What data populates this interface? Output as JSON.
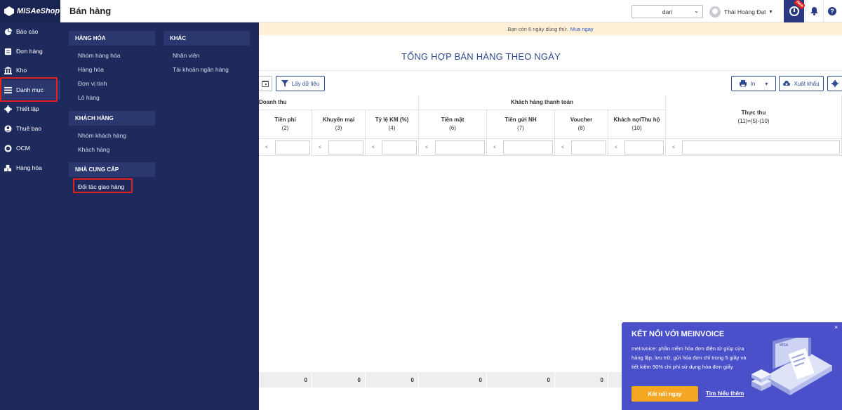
{
  "brand": {
    "name": "MISAeShop"
  },
  "sidebar": {
    "items": [
      {
        "label": "Báo cáo",
        "icon": "pie-chart-icon"
      },
      {
        "label": "Đơn hàng",
        "icon": "order-icon"
      },
      {
        "label": "Kho",
        "icon": "warehouse-icon"
      },
      {
        "label": "Danh mục",
        "icon": "list-icon"
      },
      {
        "label": "Thiết lập",
        "icon": "gear-icon"
      },
      {
        "label": "Thuê bao",
        "icon": "user-icon"
      },
      {
        "label": "OCM",
        "icon": "ocm-icon"
      },
      {
        "label": "Hàng hóa",
        "icon": "boxes-icon"
      }
    ]
  },
  "header": {
    "title": "Bán hàng",
    "store": "dari",
    "user": "Thái Hoàng Đạt",
    "new_badge": "New"
  },
  "trial": {
    "text": "Bạn còn 6 ngày dùng thử.",
    "link": "Mua ngay"
  },
  "menu": {
    "hang_hoa": {
      "title": "HÀNG HÓA",
      "items": [
        "Nhóm hàng hóa",
        "Hàng hóa",
        "Đơn vị tính",
        "Lô hàng"
      ]
    },
    "khach_hang": {
      "title": "KHÁCH HÀNG",
      "items": [
        "Nhóm khách hàng",
        "Khách hàng"
      ]
    },
    "nha_cung_cap": {
      "title": "NHÀ CUNG CẤP",
      "items": [
        "Đối tác giao hàng"
      ]
    },
    "khac": {
      "title": "KHÁC",
      "items": [
        "Nhân viên",
        "Tài khoản ngân hàng"
      ]
    }
  },
  "report": {
    "title": "TỔNG HỢP BÁN HÀNG THEO NGÀY",
    "filter_button": "Lấy dữ liệu",
    "print_button": "In",
    "export_button": "Xuất khẩu",
    "group_revenue": "Doanh thu",
    "group_payment": "Khách hàng thanh toán",
    "columns": [
      {
        "label": "Tiền phí",
        "num": "(2)"
      },
      {
        "label": "Khuyến mại",
        "num": "(3)"
      },
      {
        "label": "Tỷ lệ KM (%)",
        "num": "(4)"
      },
      {
        "label": "Tiền mặt",
        "num": "(6)"
      },
      {
        "label": "Tiền gửi NH",
        "num": "(7)"
      },
      {
        "label": "Voucher",
        "num": "(8)"
      },
      {
        "label": "Khách nợ/Thu hộ",
        "num": "(10)"
      },
      {
        "label": "Thực thu",
        "num": "(11)=(5)-(10)"
      }
    ],
    "filter_op": "≤",
    "totals": [
      "0",
      "0",
      "0",
      "0",
      "0",
      "0"
    ]
  },
  "promo": {
    "title": "KẾT NỐI VỚI MEINVOICE",
    "description": "meInvoice: phần mềm hóa đơn điện tử giúp cửa hàng lập, lưu trữ, gửi hóa đơn chỉ trong 5 giây và tiết kiệm 90% chi phí sử dụng hóa đơn giấy",
    "cta": "Kết nối ngay",
    "more": "Tìm hiểu thêm",
    "art_brand": "MISA"
  },
  "colors": {
    "sidebar": "#1f2a5c",
    "accent": "#2f4b8f",
    "highlight": "#e0201a",
    "cta": "#f5a623",
    "promo": "#4a50c9"
  }
}
